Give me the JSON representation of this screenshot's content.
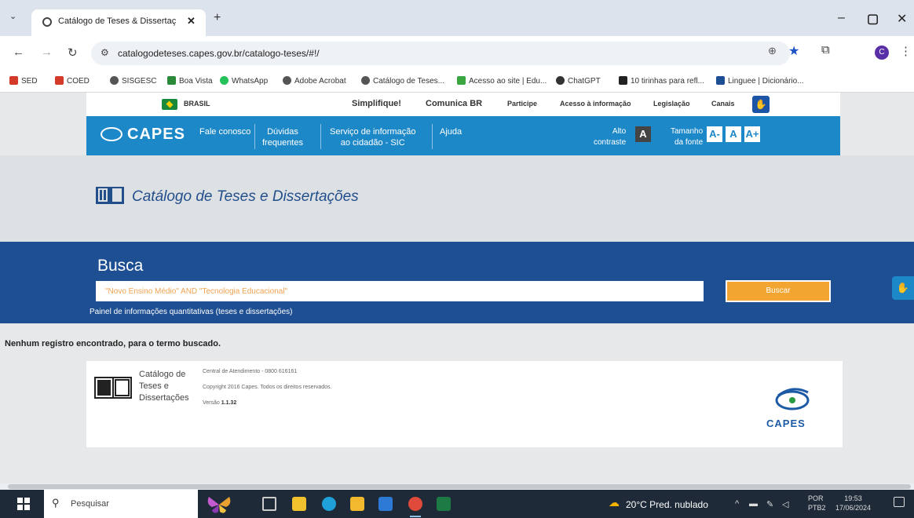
{
  "browser": {
    "tab_title": "Catálogo de Teses & Dissertaç",
    "url": "catalogodeteses.capes.gov.br/catalogo-teses/#!/",
    "avatar_letter": "C"
  },
  "bookmarks": [
    "SED",
    "COED",
    "SISGESC",
    "Boa Vista",
    "WhatsApp",
    "Adobe Acrobat",
    "Catálogo de Teses...",
    "Acesso ao site | Edu...",
    "ChatGPT",
    "10 tirinhas para refl...",
    "Linguee | Dicionário..."
  ],
  "govbar": {
    "brasil": "BRASIL",
    "items": [
      "Simplifique!",
      "Comunica BR",
      "Participe",
      "Acesso à informação",
      "Legislação",
      "Canais"
    ]
  },
  "header": {
    "logo": "CAPES",
    "nav": {
      "fale": "Fale conosco",
      "duvidas_1": "Dúvidas",
      "duvidas_2": "frequentes",
      "servico_1": "Serviço de informação",
      "servico_2": "ao cidadão - SIC",
      "ajuda": "Ajuda"
    },
    "alto_1": "Alto",
    "alto_2": "contraste",
    "alto_box": "A",
    "tamanho_1": "Tamanho",
    "tamanho_2": "da fonte",
    "font_minus": "A-",
    "font_normal": "A",
    "font_plus": "A+"
  },
  "catalog_title": "Catálogo de Teses e Dissertações",
  "search": {
    "label": "Busca",
    "query": "\"Novo Ensino Médio\" AND \"Tecnologia Educacional\"",
    "button": "Buscar",
    "painel_link": "Painel de informações quantitativas (teses e dissertações)"
  },
  "message": "Nenhum registro encontrado, para o termo buscado.",
  "footer": {
    "cat_1": "Catálogo de",
    "cat_2": "Teses e",
    "cat_3": "Dissertações",
    "central": "Central de Atendimento - 0800 616161",
    "copyright": "Copyright 2016 Capes. Todos os direitos reservados.",
    "versao_label": "Versão",
    "versao": "1.1.32",
    "logo_text": "CAPES"
  },
  "taskbar": {
    "search_placeholder": "Pesquisar",
    "weather": "20°C  Pred. nublado",
    "lang_1": "POR",
    "lang_2": "PTB2",
    "time": "19:53",
    "date": "17/06/2024"
  },
  "colors": {
    "header_blue": "#1d88c8",
    "search_blue": "#1e4f93",
    "button_orange": "#f2a531"
  }
}
